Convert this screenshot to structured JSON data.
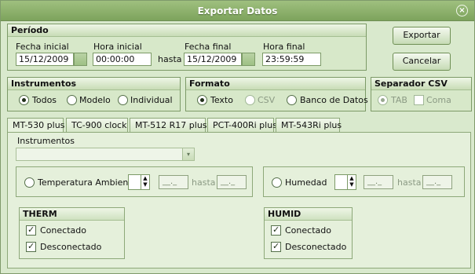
{
  "window": {
    "title": "Exportar Datos",
    "close_glyph": "×"
  },
  "periodo": {
    "header": "Período",
    "fecha_inicial_label": "Fecha inicial",
    "fecha_inicial_value": "15/12/2009",
    "hora_inicial_label": "Hora inicial",
    "hora_inicial_value": "00:00:00",
    "hasta_label": "hasta",
    "fecha_final_label": "Fecha final",
    "fecha_final_value": "15/12/2009",
    "hora_final_label": "Hora final",
    "hora_final_value": "23:59:59"
  },
  "buttons": {
    "exportar": "Exportar",
    "cancelar": "Cancelar"
  },
  "instrumentos_panel": {
    "header": "Instrumentos",
    "options": [
      "Todos",
      "Modelo",
      "Individual"
    ],
    "selected": "Todos"
  },
  "formato_panel": {
    "header": "Formato",
    "options": [
      "Texto",
      "CSV",
      "Banco de Datos"
    ],
    "selected": "Texto"
  },
  "separador_panel": {
    "header": "Separador CSV",
    "options": [
      "TAB",
      "Coma"
    ],
    "selected": "TAB"
  },
  "tabs": [
    "MT-530 plus",
    "TC-900 clock",
    "MT-512 R17 plus",
    "PCT-400Ri plus",
    "MT-543Ri plus"
  ],
  "tab_content": {
    "instrumentos_label": "Instrumentos",
    "instrumentos_value": "",
    "temperatura_label": "Temperatura Ambiente",
    "temperatura_from": "__._",
    "temperatura_hasta": "hasta",
    "temperatura_to": "__._",
    "humedad_label": "Humedad",
    "humedad_from": "__._",
    "humedad_hasta": "hasta",
    "humedad_to": "__._",
    "therm_header": "THERM",
    "therm_conectado": "Conectado",
    "therm_desconectado": "Desconectado",
    "humid_header": "HUMID",
    "humid_conectado": "Conectado",
    "humid_desconectado": "Desconectado",
    "combo_arrow": "▾",
    "spinner_up": "▲",
    "spinner_down": "▼"
  }
}
